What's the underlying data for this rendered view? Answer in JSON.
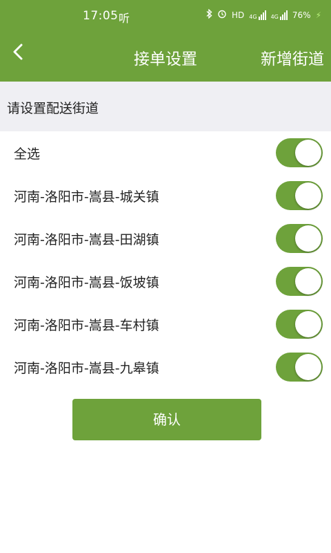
{
  "status_bar": {
    "time": "17:05",
    "listen_icon_text": "听",
    "hd_text": "HD",
    "network_1": "4G",
    "network_2": "4G",
    "battery": "76%"
  },
  "nav": {
    "title": "接单设置",
    "add_street_label": "新增街道"
  },
  "section": {
    "header": "请设置配送街道"
  },
  "list": {
    "items": [
      {
        "label": "全选",
        "on": true
      },
      {
        "label": "河南-洛阳市-嵩县-城关镇",
        "on": true
      },
      {
        "label": "河南-洛阳市-嵩县-田湖镇",
        "on": true
      },
      {
        "label": "河南-洛阳市-嵩县-饭坡镇",
        "on": true
      },
      {
        "label": "河南-洛阳市-嵩县-车村镇",
        "on": true
      },
      {
        "label": "河南-洛阳市-嵩县-九皋镇",
        "on": true
      }
    ]
  },
  "confirm_label": "确认",
  "colors": {
    "primary_green": "#6ea23b",
    "section_bg": "#efeff3"
  }
}
